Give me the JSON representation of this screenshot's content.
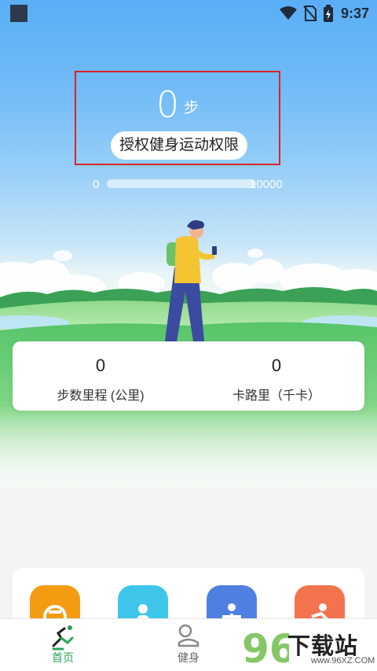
{
  "status_bar": {
    "time": "9:37",
    "icons": [
      "wifi-icon",
      "no-sim-icon",
      "battery-charging-icon"
    ]
  },
  "steps": {
    "count": "0",
    "unit": "步",
    "auth_button_label": "授权健身运动权限"
  },
  "progress": {
    "min_label": "0",
    "max_label": "10000",
    "fraction": 0
  },
  "stats": {
    "distance": {
      "value": "0",
      "label": "步数里程 (公里)"
    },
    "calories": {
      "value": "0",
      "label": "卡路里（千卡）"
    }
  },
  "features": [
    {
      "icon": "scale-icon",
      "color": "#f39c12"
    },
    {
      "icon": "person-icon",
      "color": "#3ec6ea"
    },
    {
      "icon": "exercise-icon",
      "color": "#4f7fe0"
    },
    {
      "icon": "workout-icon",
      "color": "#f4734f"
    }
  ],
  "nav": {
    "home_label": "首页",
    "fitness_label": "健身"
  },
  "watermark": {
    "text": "下载站",
    "logo": "96",
    "url": "www.96XZ.COM"
  },
  "colors": {
    "accent": "#2aa35a",
    "sky": "#5aaef6",
    "grass": "#5ec86a",
    "highlight_box": "#d8242c"
  }
}
